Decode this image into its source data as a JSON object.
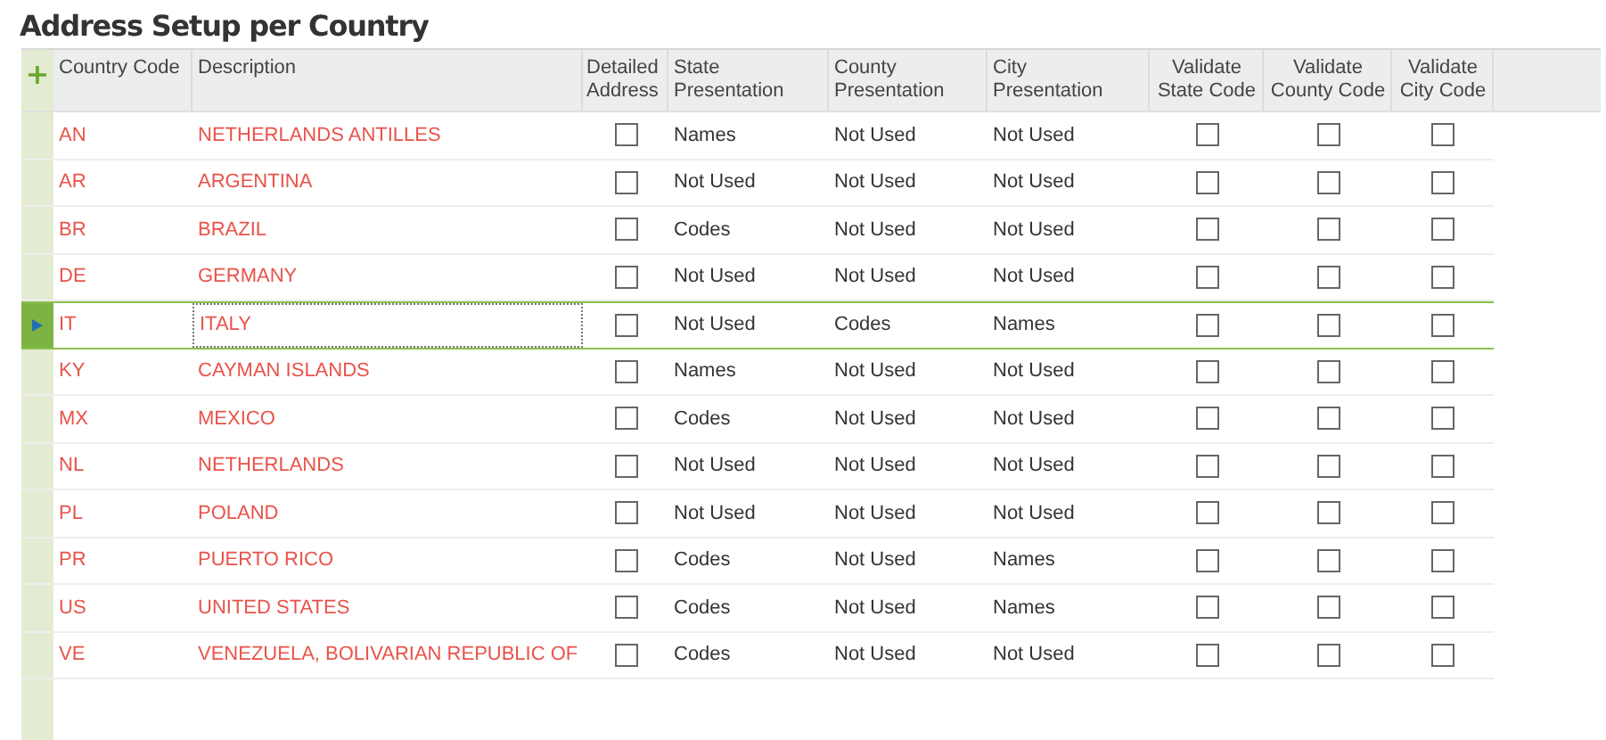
{
  "title": "Address Setup per Country",
  "add_button": "+",
  "columns": [
    "Country Code",
    "Description",
    "Detailed Address",
    "State Presentation",
    "County Presentation",
    "City Presentation",
    "Validate State Code",
    "Validate County Code",
    "Validate City Code"
  ],
  "rows": [
    {
      "code": "AN",
      "description": "NETHERLANDS ANTILLES",
      "detailed_address": false,
      "state": "Names",
      "county": "Not Used",
      "city": "Not Used",
      "validate_state": false,
      "validate_county": false,
      "validate_city": false,
      "selected": false
    },
    {
      "code": "AR",
      "description": "ARGENTINA",
      "detailed_address": false,
      "state": "Not Used",
      "county": "Not Used",
      "city": "Not Used",
      "validate_state": false,
      "validate_county": false,
      "validate_city": false,
      "selected": false
    },
    {
      "code": "BR",
      "description": "BRAZIL",
      "detailed_address": false,
      "state": "Codes",
      "county": "Not Used",
      "city": "Not Used",
      "validate_state": false,
      "validate_county": false,
      "validate_city": false,
      "selected": false
    },
    {
      "code": "DE",
      "description": "GERMANY",
      "detailed_address": false,
      "state": "Not Used",
      "county": "Not Used",
      "city": "Not Used",
      "validate_state": false,
      "validate_county": false,
      "validate_city": false,
      "selected": false
    },
    {
      "code": "IT",
      "description": "ITALY",
      "detailed_address": false,
      "state": "Not Used",
      "county": "Codes",
      "city": "Names",
      "validate_state": false,
      "validate_county": false,
      "validate_city": false,
      "selected": true
    },
    {
      "code": "KY",
      "description": "CAYMAN ISLANDS",
      "detailed_address": false,
      "state": "Names",
      "county": "Not Used",
      "city": "Not Used",
      "validate_state": false,
      "validate_county": false,
      "validate_city": false,
      "selected": false
    },
    {
      "code": "MX",
      "description": "MEXICO",
      "detailed_address": false,
      "state": "Codes",
      "county": "Not Used",
      "city": "Not Used",
      "validate_state": false,
      "validate_county": false,
      "validate_city": false,
      "selected": false
    },
    {
      "code": "NL",
      "description": "NETHERLANDS",
      "detailed_address": false,
      "state": "Not Used",
      "county": "Not Used",
      "city": "Not Used",
      "validate_state": false,
      "validate_county": false,
      "validate_city": false,
      "selected": false
    },
    {
      "code": "PL",
      "description": "POLAND",
      "detailed_address": false,
      "state": "Not Used",
      "county": "Not Used",
      "city": "Not Used",
      "validate_state": false,
      "validate_county": false,
      "validate_city": false,
      "selected": false
    },
    {
      "code": "PR",
      "description": "PUERTO RICO",
      "detailed_address": false,
      "state": "Codes",
      "county": "Not Used",
      "city": "Names",
      "validate_state": false,
      "validate_county": false,
      "validate_city": false,
      "selected": false
    },
    {
      "code": "US",
      "description": "UNITED STATES",
      "detailed_address": false,
      "state": "Codes",
      "county": "Not Used",
      "city": "Names",
      "validate_state": false,
      "validate_county": false,
      "validate_city": false,
      "selected": false
    },
    {
      "code": "VE",
      "description": "VENEZUELA, BOLIVARIAN REPUBLIC OF",
      "detailed_address": false,
      "state": "Codes",
      "county": "Not Used",
      "city": "Not Used",
      "validate_state": false,
      "validate_county": false,
      "validate_city": false,
      "selected": false
    }
  ]
}
